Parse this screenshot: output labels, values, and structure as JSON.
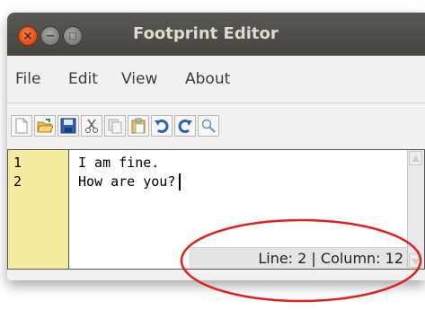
{
  "window": {
    "title": "Footprint Editor",
    "controls": [
      "close-icon",
      "minimize-icon",
      "maximize-icon"
    ]
  },
  "menu": {
    "items": [
      "File",
      "Edit",
      "View",
      "About"
    ]
  },
  "toolbar": {
    "buttons": [
      "new-file-icon",
      "open-folder-icon",
      "save-icon",
      "cut-icon",
      "copy-icon",
      "paste-icon",
      "undo-icon",
      "redo-icon",
      "find-icon"
    ]
  },
  "editor": {
    "line_numbers": [
      "1",
      "2"
    ],
    "lines": [
      "I am fine.",
      "How are you?"
    ],
    "status": "Line: 2 | Column: 12"
  },
  "colors": {
    "titlebar": "#4e4d48",
    "close_button": "#dd4814",
    "gutter": "#f4eda0",
    "annotation": "#e0201c"
  }
}
